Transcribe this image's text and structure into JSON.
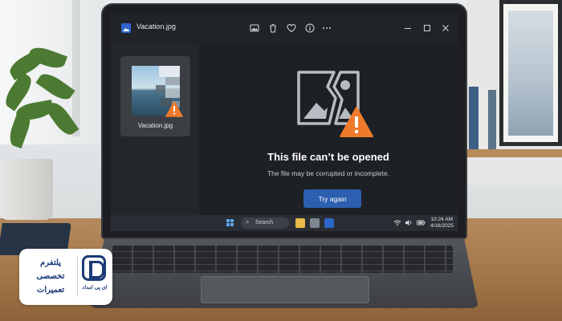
{
  "window": {
    "title": "Vacation.jpg",
    "toolbar_icons": [
      "image-edit-icon",
      "trash-icon",
      "heart-icon",
      "info-icon",
      "more-icon"
    ],
    "controls": [
      "minimize-icon",
      "maximize-icon",
      "close-icon"
    ]
  },
  "sidebar": {
    "thumbnail_label": "Vacation.jpg"
  },
  "error": {
    "title": "This file can’t be opened",
    "message": "The file may be corrupted or incomplete.",
    "button_label": "Try again",
    "warning_color": "#f07a2b"
  },
  "taskbar": {
    "search_placeholder": "Search",
    "time": "10:24 AM",
    "date": "4/16/2025"
  },
  "badge": {
    "line1": "پلتفرم",
    "line2": "تخصصی",
    "line3": "تعمیرات",
    "brand": "ای پی امداد"
  },
  "colors": {
    "accent": "#2c5fb0",
    "background": "#1d2024",
    "brand": "#1b3b78"
  }
}
